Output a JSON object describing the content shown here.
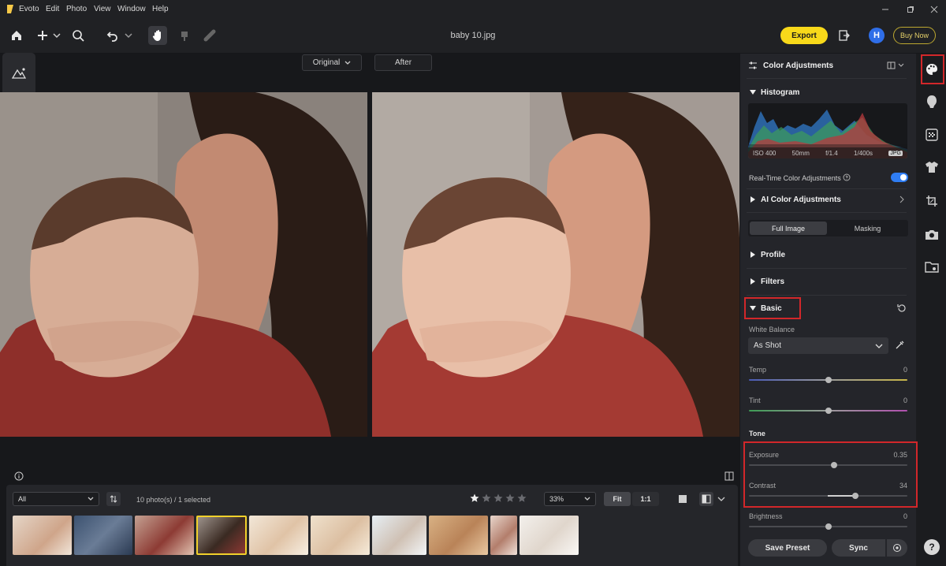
{
  "menubar": {
    "app_name": "Evoto",
    "items": [
      "Edit",
      "Photo",
      "View",
      "Window",
      "Help"
    ]
  },
  "toolbar": {
    "file_name": "baby 10.jpg",
    "export_label": "Export",
    "avatar_letter": "H",
    "buy_now_label": "Buy Now"
  },
  "view": {
    "original_label": "Original",
    "after_label": "After"
  },
  "right_panel": {
    "title": "Color Adjustments",
    "histogram": {
      "label": "Histogram",
      "iso": "ISO 400",
      "focal": "50mm",
      "aperture": "f/1.4",
      "shutter": "1/400s",
      "format": "JPG"
    },
    "realtime_label": "Real-Time Color Adjustments",
    "realtime_on": true,
    "ai_label": "AI Color Adjustments",
    "tabs": [
      "Full Image",
      "Masking"
    ],
    "profile_label": "Profile",
    "filters_label": "Filters",
    "basic_label": "Basic",
    "white_balance_label": "White Balance",
    "white_balance_value": "As Shot",
    "sliders": [
      {
        "label": "Temp",
        "value": "0",
        "position": 0.5
      },
      {
        "label": "Tint",
        "value": "0",
        "position": 0.5
      }
    ],
    "tone_label": "Tone",
    "tone_sliders": [
      {
        "label": "Exposure",
        "value": "0.35",
        "position": 0.535
      },
      {
        "label": "Contrast",
        "value": "34",
        "position": 0.67
      },
      {
        "label": "Brightness",
        "value": "0",
        "position": 0.5
      }
    ],
    "save_preset_label": "Save Preset",
    "sync_label": "Sync"
  },
  "filmstrip": {
    "filter_value": "All",
    "count_text": "10 photo(s) / 1 selected",
    "rating_stars": 5,
    "zoom_value": "33%",
    "fit_label": "Fit",
    "one_to_one_label": "1:1"
  },
  "colors": {
    "accent": "#f8d91a",
    "highlight": "#d2272a",
    "toggle": "#2f7df3"
  }
}
